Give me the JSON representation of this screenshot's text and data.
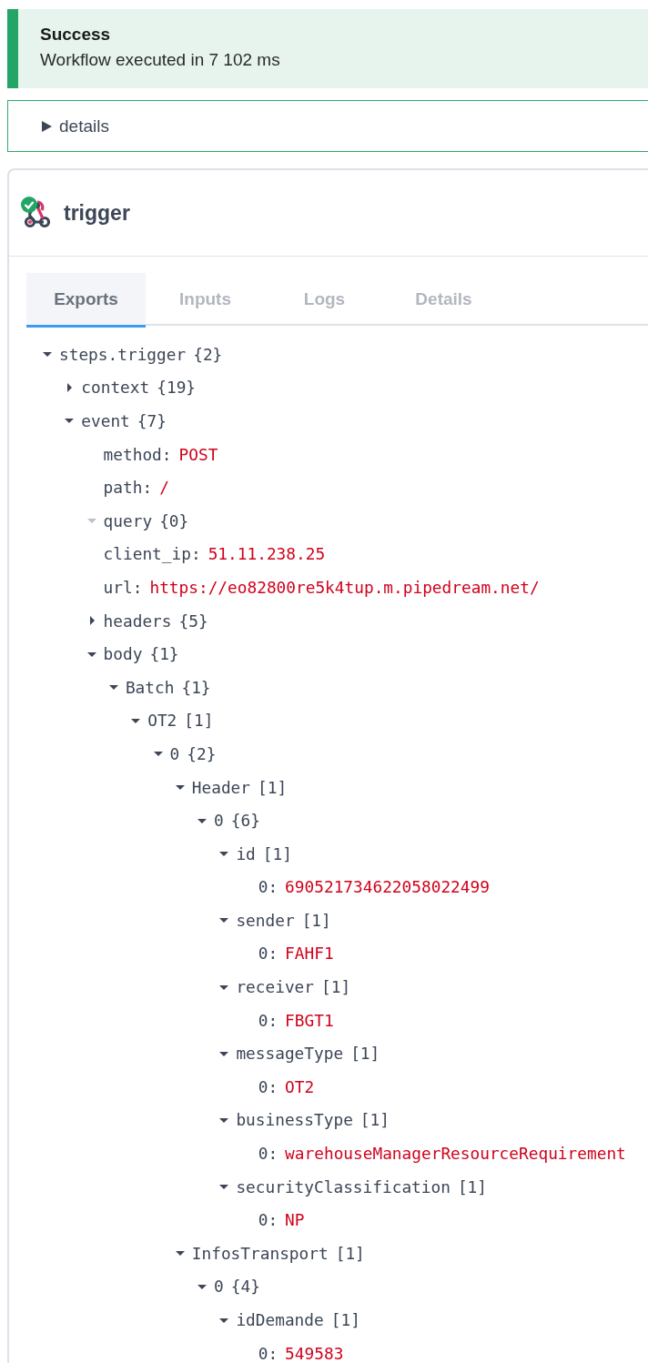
{
  "alert": {
    "title": "Success",
    "message": "Workflow executed in 7 102 ms"
  },
  "details": {
    "label": "details",
    "expanded": false
  },
  "step": {
    "name": "trigger",
    "tabs": [
      {
        "label": "Exports",
        "selected": true
      },
      {
        "label": "Inputs",
        "selected": false
      },
      {
        "label": "Logs",
        "selected": false
      },
      {
        "label": "Details",
        "selected": false
      }
    ],
    "tree": [
      {
        "kind": "branch",
        "label": "steps.trigger",
        "count": "{2}",
        "expanded": true,
        "children": [
          {
            "kind": "branch",
            "label": "context",
            "count": "{19}",
            "expanded": false
          },
          {
            "kind": "branch",
            "label": "event",
            "count": "{7}",
            "expanded": true,
            "children": [
              {
                "kind": "leaf",
                "label": "method:",
                "value": "POST"
              },
              {
                "kind": "leaf",
                "label": "path:",
                "value": "/"
              },
              {
                "kind": "empty",
                "label": "query",
                "count": "{0}"
              },
              {
                "kind": "leaf",
                "label": "client_ip:",
                "value": "51.11.238.25"
              },
              {
                "kind": "leaf",
                "label": "url:",
                "value": "https://eo82800re5k4tup.m.pipedream.net/"
              },
              {
                "kind": "branch",
                "label": "headers",
                "count": "{5}",
                "expanded": false
              },
              {
                "kind": "branch",
                "label": "body",
                "count": "{1}",
                "expanded": true,
                "children": [
                  {
                    "kind": "branch",
                    "label": "Batch",
                    "count": "{1}",
                    "expanded": true,
                    "children": [
                      {
                        "kind": "branch",
                        "label": "OT2",
                        "count": "[1]",
                        "expanded": true,
                        "children": [
                          {
                            "kind": "branch",
                            "label": "0",
                            "count": "{2}",
                            "expanded": true,
                            "children": [
                              {
                                "kind": "branch",
                                "label": "Header",
                                "count": "[1]",
                                "expanded": true,
                                "children": [
                                  {
                                    "kind": "branch",
                                    "label": "0",
                                    "count": "{6}",
                                    "expanded": true,
                                    "children": [
                                      {
                                        "kind": "branch",
                                        "label": "id",
                                        "count": "[1]",
                                        "expanded": true,
                                        "children": [
                                          {
                                            "kind": "leaf",
                                            "label": "0:",
                                            "value": "690521734622058022499"
                                          }
                                        ]
                                      },
                                      {
                                        "kind": "branch",
                                        "label": "sender",
                                        "count": "[1]",
                                        "expanded": true,
                                        "children": [
                                          {
                                            "kind": "leaf",
                                            "label": "0:",
                                            "value": "FAHF1"
                                          }
                                        ]
                                      },
                                      {
                                        "kind": "branch",
                                        "label": "receiver",
                                        "count": "[1]",
                                        "expanded": true,
                                        "children": [
                                          {
                                            "kind": "leaf",
                                            "label": "0:",
                                            "value": "FBGT1"
                                          }
                                        ]
                                      },
                                      {
                                        "kind": "branch",
                                        "label": "messageType",
                                        "count": "[1]",
                                        "expanded": true,
                                        "children": [
                                          {
                                            "kind": "leaf",
                                            "label": "0:",
                                            "value": "OT2"
                                          }
                                        ]
                                      },
                                      {
                                        "kind": "branch",
                                        "label": "businessType",
                                        "count": "[1]",
                                        "expanded": true,
                                        "children": [
                                          {
                                            "kind": "leaf",
                                            "label": "0:",
                                            "value": "warehouseManagerResourceRequirement"
                                          }
                                        ]
                                      },
                                      {
                                        "kind": "branch",
                                        "label": "securityClassification",
                                        "count": "[1]",
                                        "expanded": true,
                                        "children": [
                                          {
                                            "kind": "leaf",
                                            "label": "0:",
                                            "value": "NP"
                                          }
                                        ]
                                      }
                                    ]
                                  }
                                ]
                              },
                              {
                                "kind": "branch",
                                "label": "InfosTransport",
                                "count": "[1]",
                                "expanded": true,
                                "children": [
                                  {
                                    "kind": "branch",
                                    "label": "0",
                                    "count": "{4}",
                                    "expanded": true,
                                    "children": [
                                      {
                                        "kind": "branch",
                                        "label": "idDemande",
                                        "count": "[1]",
                                        "expanded": true,
                                        "children": [
                                          {
                                            "kind": "leaf",
                                            "label": "0:",
                                            "value": "549583"
                                          }
                                        ]
                                      }
                                    ]
                                  }
                                ]
                              }
                            ]
                          }
                        ]
                      }
                    ]
                  }
                ]
              }
            ]
          }
        ]
      }
    ]
  }
}
